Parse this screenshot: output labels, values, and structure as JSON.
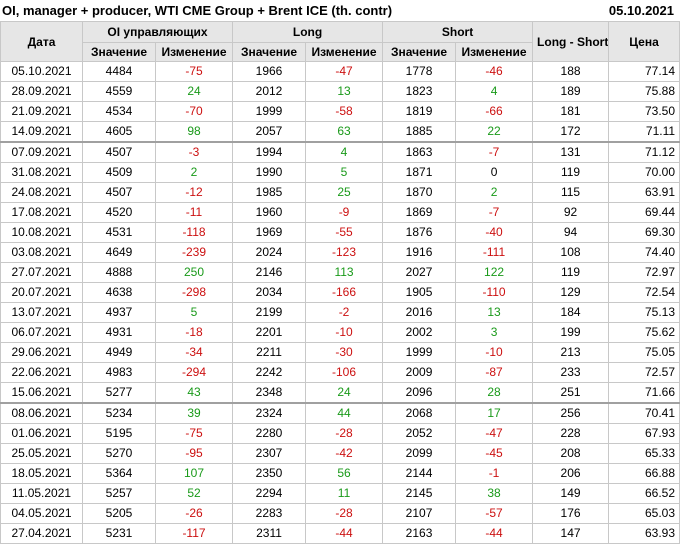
{
  "header": {
    "title": "OI, manager + producer, WTI CME Group + Brent ICE (th. contr)",
    "date": "05.10.2021"
  },
  "columns": {
    "date": "Дата",
    "oi": "OI управляющих",
    "long": "Long",
    "short": "Short",
    "long_short": "Long - Short",
    "price": "Цена",
    "value": "Значение",
    "change": "Изменение"
  },
  "colors": {
    "positive": "#1a9a1a",
    "negative": "#cc1010",
    "header_bg": "#e6e6e6"
  },
  "rows": [
    {
      "date": "05.10.2021",
      "oi": "4484",
      "oi_chg": "-75",
      "long": "1966",
      "long_chg": "-47",
      "short": "1778",
      "short_chg": "-46",
      "ls": "188",
      "price": "77.14"
    },
    {
      "date": "28.09.2021",
      "oi": "4559",
      "oi_chg": "24",
      "long": "2012",
      "long_chg": "13",
      "short": "1823",
      "short_chg": "4",
      "ls": "189",
      "price": "75.88"
    },
    {
      "date": "21.09.2021",
      "oi": "4534",
      "oi_chg": "-70",
      "long": "1999",
      "long_chg": "-58",
      "short": "1819",
      "short_chg": "-66",
      "ls": "181",
      "price": "73.50"
    },
    {
      "date": "14.09.2021",
      "oi": "4605",
      "oi_chg": "98",
      "long": "2057",
      "long_chg": "63",
      "short": "1885",
      "short_chg": "22",
      "ls": "172",
      "price": "71.11"
    },
    {
      "date": "07.09.2021",
      "oi": "4507",
      "oi_chg": "-3",
      "long": "1994",
      "long_chg": "4",
      "short": "1863",
      "short_chg": "-7",
      "ls": "131",
      "price": "71.12",
      "group": true
    },
    {
      "date": "31.08.2021",
      "oi": "4509",
      "oi_chg": "2",
      "long": "1990",
      "long_chg": "5",
      "short": "1871",
      "short_chg": "0",
      "ls": "119",
      "price": "70.00"
    },
    {
      "date": "24.08.2021",
      "oi": "4507",
      "oi_chg": "-12",
      "long": "1985",
      "long_chg": "25",
      "short": "1870",
      "short_chg": "2",
      "ls": "115",
      "price": "63.91"
    },
    {
      "date": "17.08.2021",
      "oi": "4520",
      "oi_chg": "-11",
      "long": "1960",
      "long_chg": "-9",
      "short": "1869",
      "short_chg": "-7",
      "ls": "92",
      "price": "69.44"
    },
    {
      "date": "10.08.2021",
      "oi": "4531",
      "oi_chg": "-118",
      "long": "1969",
      "long_chg": "-55",
      "short": "1876",
      "short_chg": "-40",
      "ls": "94",
      "price": "69.30"
    },
    {
      "date": "03.08.2021",
      "oi": "4649",
      "oi_chg": "-239",
      "long": "2024",
      "long_chg": "-123",
      "short": "1916",
      "short_chg": "-111",
      "ls": "108",
      "price": "74.40"
    },
    {
      "date": "27.07.2021",
      "oi": "4888",
      "oi_chg": "250",
      "long": "2146",
      "long_chg": "113",
      "short": "2027",
      "short_chg": "122",
      "ls": "119",
      "price": "72.97"
    },
    {
      "date": "20.07.2021",
      "oi": "4638",
      "oi_chg": "-298",
      "long": "2034",
      "long_chg": "-166",
      "short": "1905",
      "short_chg": "-110",
      "ls": "129",
      "price": "72.54"
    },
    {
      "date": "13.07.2021",
      "oi": "4937",
      "oi_chg": "5",
      "long": "2199",
      "long_chg": "-2",
      "short": "2016",
      "short_chg": "13",
      "ls": "184",
      "price": "75.13"
    },
    {
      "date": "06.07.2021",
      "oi": "4931",
      "oi_chg": "-18",
      "long": "2201",
      "long_chg": "-10",
      "short": "2002",
      "short_chg": "3",
      "ls": "199",
      "price": "75.62"
    },
    {
      "date": "29.06.2021",
      "oi": "4949",
      "oi_chg": "-34",
      "long": "2211",
      "long_chg": "-30",
      "short": "1999",
      "short_chg": "-10",
      "ls": "213",
      "price": "75.05"
    },
    {
      "date": "22.06.2021",
      "oi": "4983",
      "oi_chg": "-294",
      "long": "2242",
      "long_chg": "-106",
      "short": "2009",
      "short_chg": "-87",
      "ls": "233",
      "price": "72.57"
    },
    {
      "date": "15.06.2021",
      "oi": "5277",
      "oi_chg": "43",
      "long": "2348",
      "long_chg": "24",
      "short": "2096",
      "short_chg": "28",
      "ls": "251",
      "price": "71.66"
    },
    {
      "date": "08.06.2021",
      "oi": "5234",
      "oi_chg": "39",
      "long": "2324",
      "long_chg": "44",
      "short": "2068",
      "short_chg": "17",
      "ls": "256",
      "price": "70.41",
      "group": true
    },
    {
      "date": "01.06.2021",
      "oi": "5195",
      "oi_chg": "-75",
      "long": "2280",
      "long_chg": "-28",
      "short": "2052",
      "short_chg": "-47",
      "ls": "228",
      "price": "67.93"
    },
    {
      "date": "25.05.2021",
      "oi": "5270",
      "oi_chg": "-95",
      "long": "2307",
      "long_chg": "-42",
      "short": "2099",
      "short_chg": "-45",
      "ls": "208",
      "price": "65.33"
    },
    {
      "date": "18.05.2021",
      "oi": "5364",
      "oi_chg": "107",
      "long": "2350",
      "long_chg": "56",
      "short": "2144",
      "short_chg": "-1",
      "ls": "206",
      "price": "66.88"
    },
    {
      "date": "11.05.2021",
      "oi": "5257",
      "oi_chg": "52",
      "long": "2294",
      "long_chg": "11",
      "short": "2145",
      "short_chg": "38",
      "ls": "149",
      "price": "66.52"
    },
    {
      "date": "04.05.2021",
      "oi": "5205",
      "oi_chg": "-26",
      "long": "2283",
      "long_chg": "-28",
      "short": "2107",
      "short_chg": "-57",
      "ls": "176",
      "price": "65.03"
    },
    {
      "date": "27.04.2021",
      "oi": "5231",
      "oi_chg": "-117",
      "long": "2311",
      "long_chg": "-44",
      "short": "2163",
      "short_chg": "-44",
      "ls": "147",
      "price": "63.93"
    }
  ]
}
